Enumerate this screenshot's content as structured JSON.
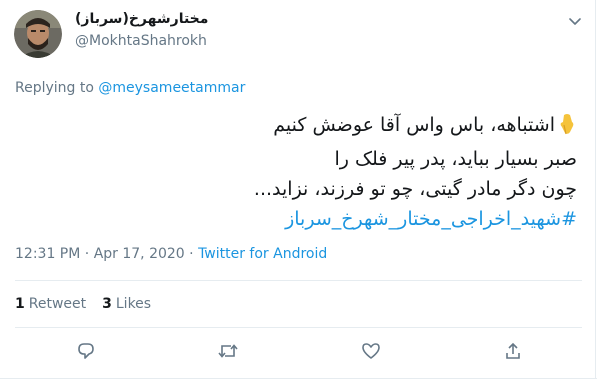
{
  "user": {
    "display_name": "مختارشهرخ(سرباز)",
    "handle": "@MokhtaShahrokh"
  },
  "reply": {
    "prefix": "Replying to ",
    "mention": "@meysameetammar"
  },
  "tweet": {
    "line1": "اشتباهه، باس واس آقا عوضش کنیم",
    "line2": "صبر بسیار بباید، پدر پیر فلک را",
    "line3": "چون دگر مادر گیتی، چو تو فرزند، نزاید...",
    "hashtag": "#شهید_اخراجی_مختار_شهرخ_سرباز"
  },
  "meta": {
    "time": "12:31 PM",
    "sep1": " · ",
    "date": "Apr 17, 2020",
    "sep2": " · ",
    "source": "Twitter for Android"
  },
  "stats": {
    "retweets": "1",
    "retweet_label": "Retweet",
    "likes": "3",
    "like_label": "Likes"
  },
  "colors": {
    "link": "#1b95e0",
    "secondary": "#657786",
    "divider": "#e6ecf0",
    "emoji": "#f5c33b"
  },
  "icons": [
    "chevron-down-icon",
    "pointing-down-hand-icon",
    "reply-icon",
    "retweet-icon",
    "like-icon",
    "share-icon"
  ]
}
